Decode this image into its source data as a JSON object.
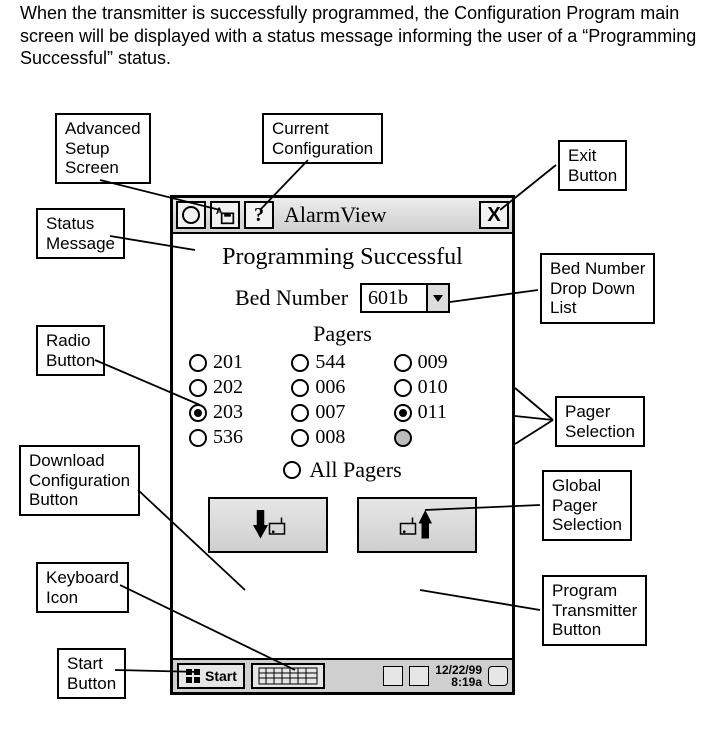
{
  "intro": "When the transmitter is successfully programmed, the Configuration Program main screen will be displayed with a status message informing the user of a “Programming Successful” status.",
  "window": {
    "title": "AlarmView",
    "close_label": "X",
    "help_label": "?"
  },
  "status": "Programming Successful",
  "bed": {
    "label": "Bed Number",
    "value": "601b"
  },
  "pagers": {
    "title": "Pagers",
    "items": [
      {
        "label": "201",
        "selected": false
      },
      {
        "label": "544",
        "selected": false
      },
      {
        "label": "009",
        "selected": false
      },
      {
        "label": "202",
        "selected": false
      },
      {
        "label": "006",
        "selected": false
      },
      {
        "label": "010",
        "selected": false
      },
      {
        "label": "203",
        "selected": true
      },
      {
        "label": "007",
        "selected": false
      },
      {
        "label": "011",
        "selected": true
      },
      {
        "label": "536",
        "selected": false
      },
      {
        "label": "008",
        "selected": false
      },
      {
        "label": "",
        "selected": false,
        "disabled": true
      }
    ],
    "all_label": "All Pagers"
  },
  "taskbar": {
    "start": "Start",
    "date": "12/22/99",
    "time": "8:19a"
  },
  "callouts": {
    "advanced_setup": "Advanced\nSetup\nScreen",
    "current_config": "Current\nConfiguration",
    "exit_button": "Exit\nButton",
    "status_message": "Status\nMessage",
    "bed_dropdown": "Bed Number\nDrop Down\nList",
    "radio_button": "Radio\nButton",
    "pager_selection": "Pager\nSelection",
    "download_cfg": "Download\nConfiguration\nButton",
    "global_pager": "Global\nPager\nSelection",
    "keyboard_icon": "Keyboard\nIcon",
    "program_tx": "Program\nTransmitter\nButton",
    "start_button": "Start\nButton"
  }
}
